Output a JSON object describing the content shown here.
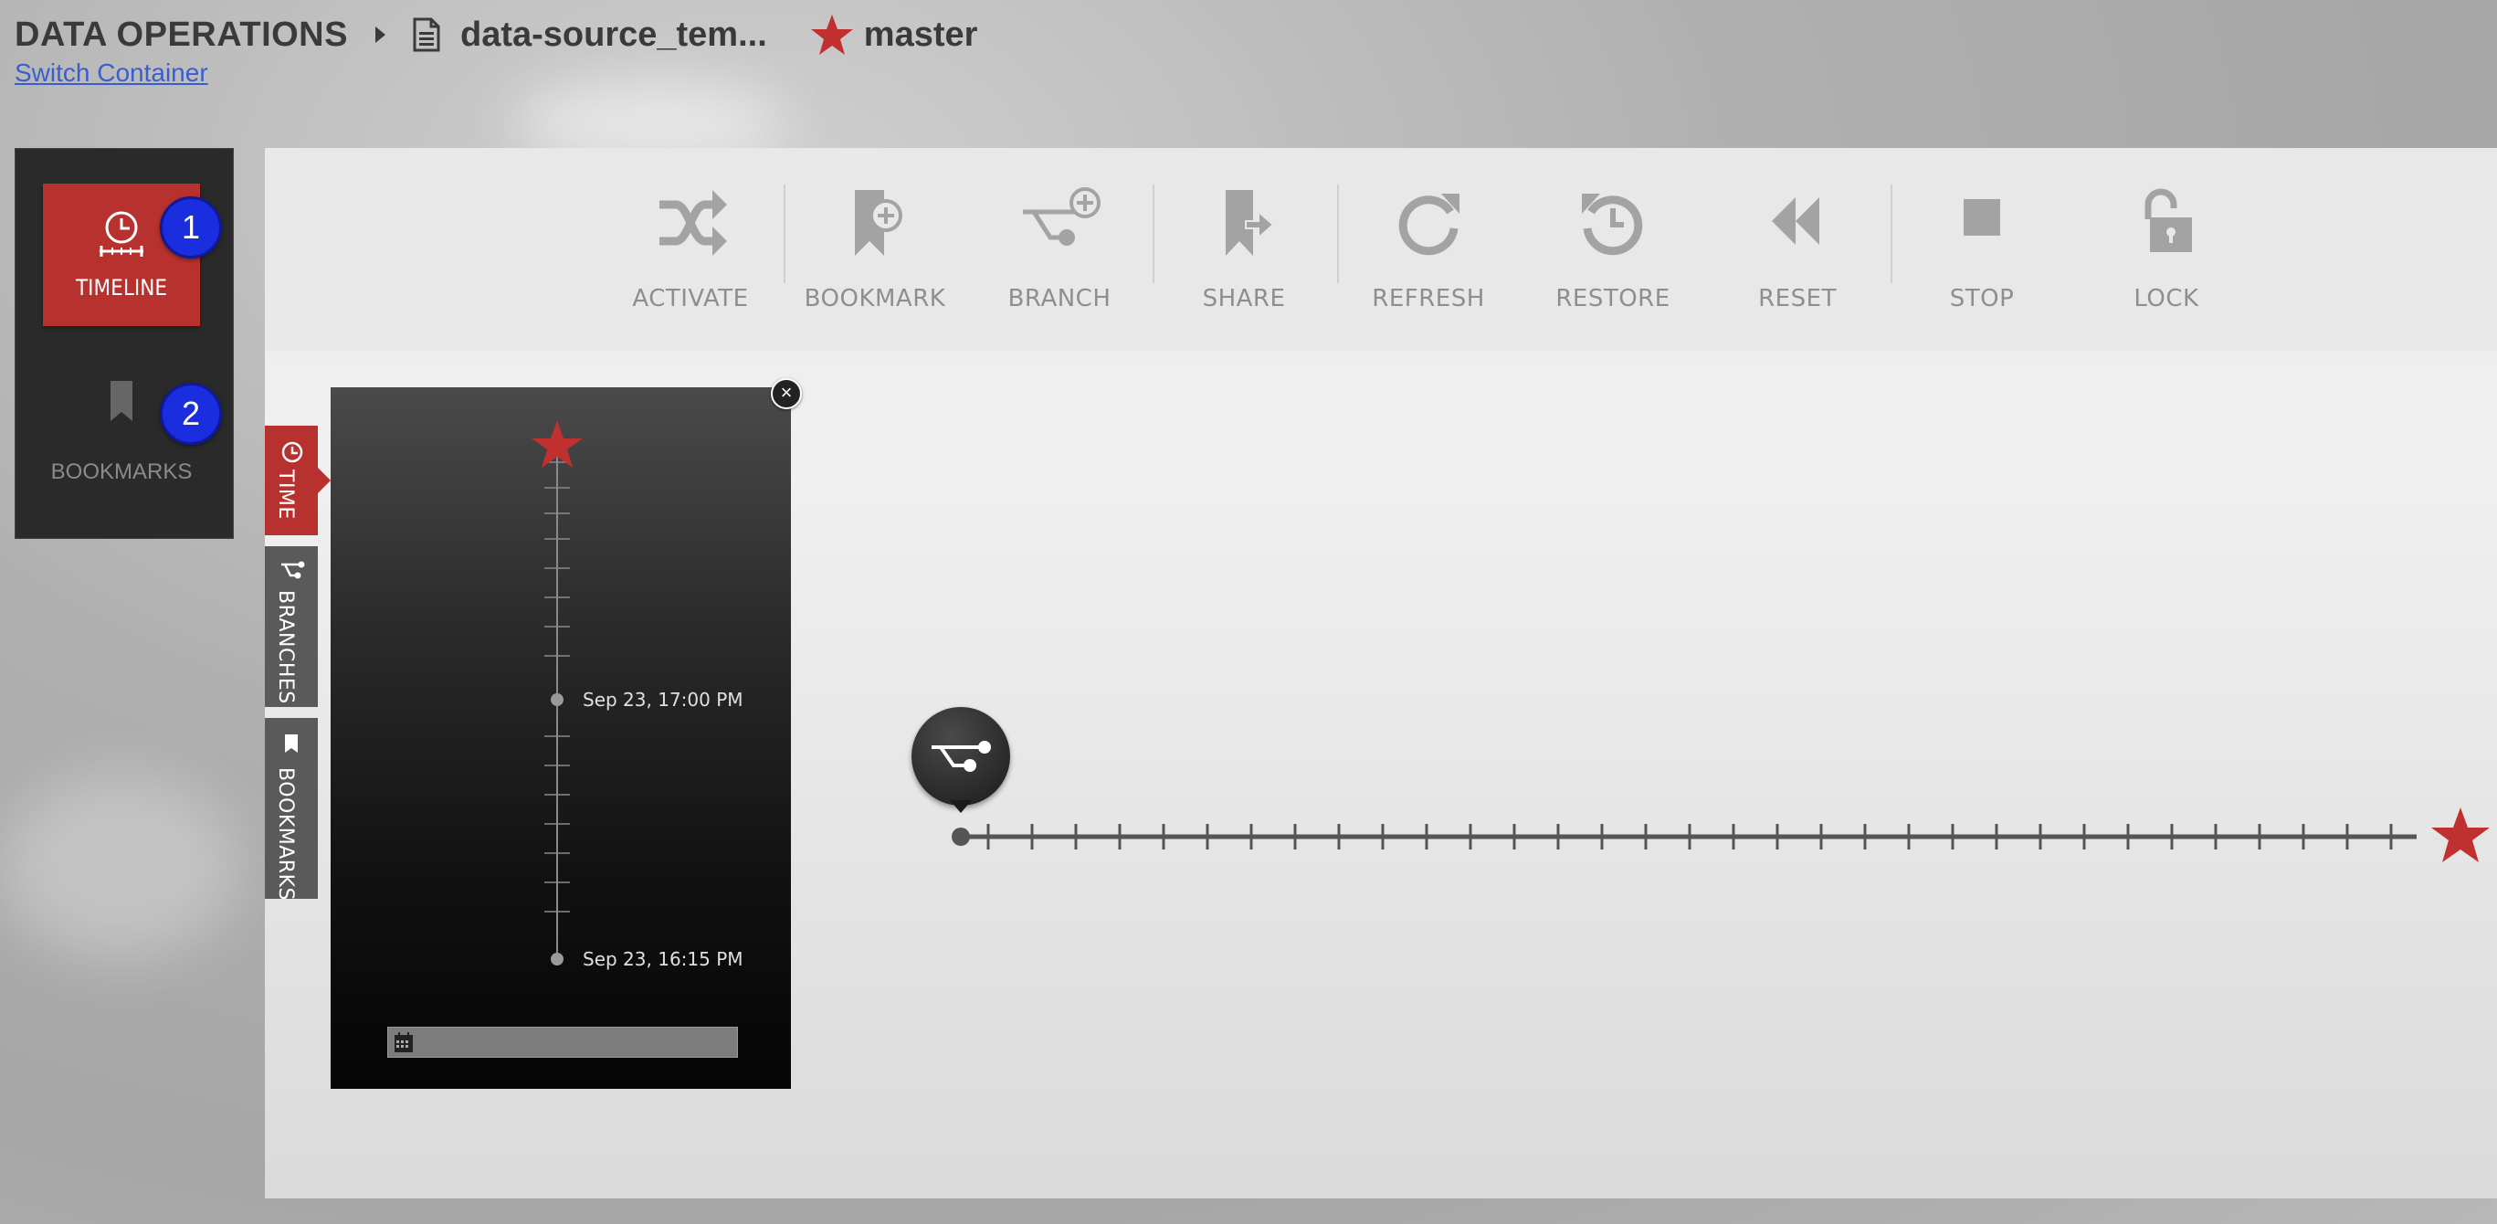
{
  "header": {
    "root": "DATA OPERATIONS",
    "file": "data-source_tem...",
    "branch": "master",
    "switch_link": "Switch Container"
  },
  "leftnav": {
    "items": [
      {
        "label": "TIMELINE",
        "icon": "timeline-clock-icon",
        "active": true,
        "badge": "1"
      },
      {
        "label": "BOOKMARKS",
        "icon": "bookmark-icon",
        "active": false,
        "badge": "2"
      }
    ]
  },
  "toolbar": {
    "buttons": [
      {
        "label": "ACTIVATE",
        "icon": "shuffle-icon"
      },
      {
        "label": "BOOKMARK",
        "icon": "bookmark-add-icon"
      },
      {
        "label": "BRANCH",
        "icon": "branch-add-icon"
      },
      {
        "label": "SHARE",
        "icon": "share-icon"
      },
      {
        "label": "REFRESH",
        "icon": "refresh-icon"
      },
      {
        "label": "RESTORE",
        "icon": "restore-icon"
      },
      {
        "label": "RESET",
        "icon": "rewind-icon"
      },
      {
        "label": "STOP",
        "icon": "stop-icon"
      },
      {
        "label": "LOCK",
        "icon": "unlock-icon"
      }
    ]
  },
  "side_tabs": [
    {
      "label": "TIME",
      "active": true
    },
    {
      "label": "BRANCHES",
      "active": false
    },
    {
      "label": "BOOKMARKS",
      "active": false
    }
  ],
  "timeline_popup": {
    "top_label": "Sep 23, 17:00 PM",
    "bottom_label": "Sep 23, 16:15 PM",
    "date_input_value": ""
  },
  "colors": {
    "accent": "#b7312f",
    "star": "#c0302e",
    "badge": "#1a2ee0",
    "link": "#3a5fcd"
  }
}
